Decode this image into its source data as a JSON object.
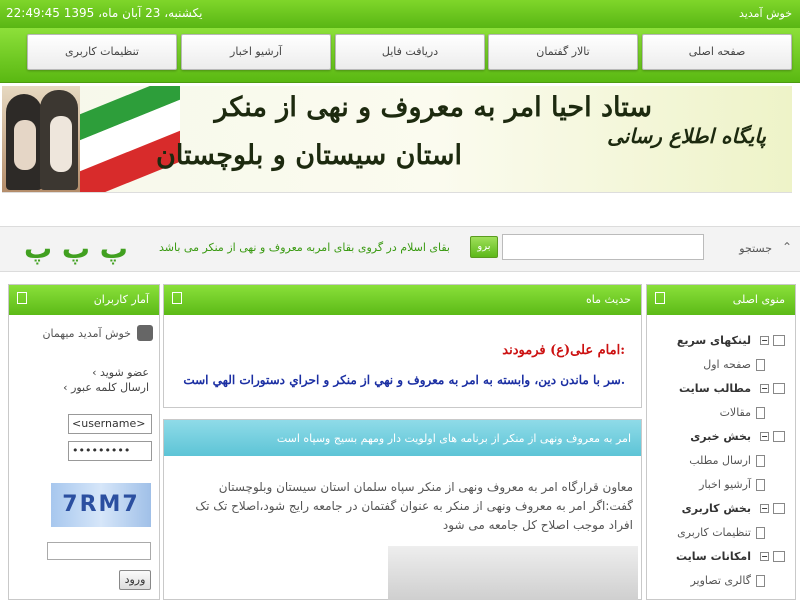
{
  "topbar": {
    "welcome": "خوش آمدید",
    "datetime": "22:49:45 یکشنبه، 23 آبان ماه، 1395"
  },
  "nav": {
    "items": [
      "صفحه اصلی",
      "تالار گفتمان",
      "دریافت فایل",
      "آرشیو اخبار",
      "تنظیمات کاربری"
    ]
  },
  "banner": {
    "title_main": "ستاد احیا امر به معروف و نهی از منکر",
    "subtitle": "پایگاه اطلاع رسانی",
    "region": "استان سیستان و بلوچستان"
  },
  "search": {
    "label": "جستجو",
    "button": "برو",
    "marquee": "بقای اسلام در گروی بقای امربه معروف و نهی از منکر می باشد",
    "peh_letters": "پ پ پ"
  },
  "left_panel": {
    "title": "آمار کاربران",
    "welcome_user": "خوش آمدید میهمان",
    "links": [
      "عضو شوید",
      "ارسال کلمه عبور"
    ],
    "username_value": "<username>",
    "password_value": "•••••••••",
    "captcha_text": "7RM7",
    "login_button": "ورود"
  },
  "center_panel": {
    "title": "حدیث ماه",
    "quote_author": "امام علی(ع) فرمودند:",
    "quote_text": "سر با ماندن دین، وابسته به امر به معروف و نهي از منكر و احراي دستورات الهي است."
  },
  "news": {
    "headline": "امر به معروف ونهی از منکر از برنامه های اولویت دار ومهم بسیج وسپاه است",
    "body": "معاون قرارگاه امر به معروف ونهی از منکر سپاه سلمان استان سیستان وبلوچستان گفت:اگر امر به معروف ونهی از منکر به عنوان گفتمان در جامعه رایج شود،اصلاح تک تک افراد موجب اصلاح کل جامعه می شود"
  },
  "right_panel": {
    "title": "منوی اصلی",
    "tree": [
      {
        "label": "لینکهای سریع",
        "bold": true
      },
      {
        "label": "صفحه اول",
        "bold": false
      },
      {
        "label": "مطالب سایت",
        "bold": true
      },
      {
        "label": "مقالات",
        "bold": false
      },
      {
        "label": "بخش خبری",
        "bold": true
      },
      {
        "label": "ارسال مطلب",
        "bold": false
      },
      {
        "label": "آرشیو اخبار",
        "bold": false
      },
      {
        "label": "بخش کاربری",
        "bold": true
      },
      {
        "label": "تنظیمات کاربری",
        "bold": false
      },
      {
        "label": "امکانات سایت",
        "bold": true
      },
      {
        "label": "گالری تصاویر",
        "bold": false
      }
    ]
  },
  "colors": {
    "accent_green": "#5cba17",
    "news_teal": "#5dc4d6",
    "quote_red": "#cc1111",
    "quote_blue": "#1b2fa3"
  }
}
